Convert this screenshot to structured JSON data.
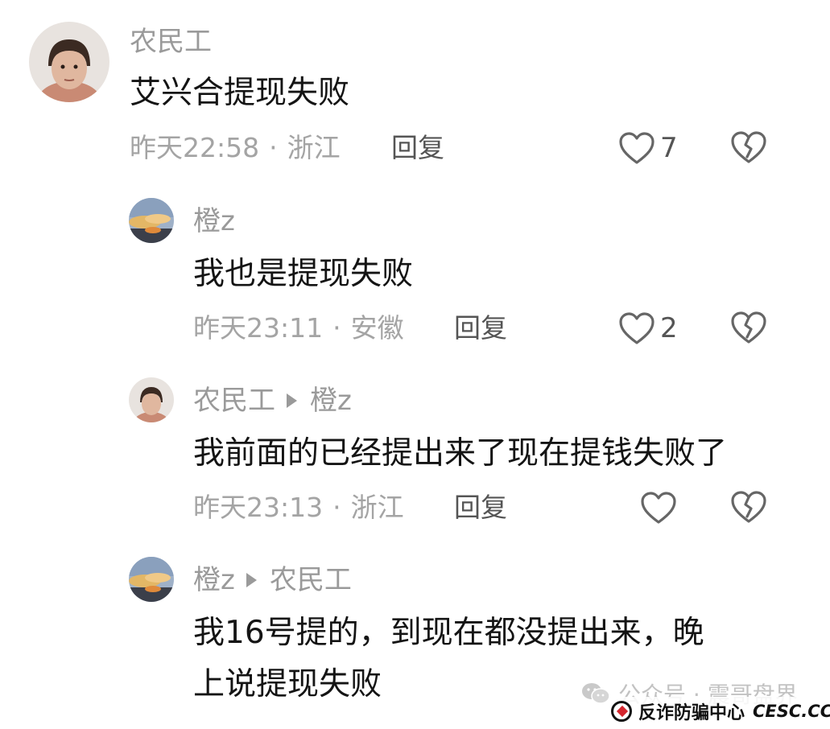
{
  "comments": [
    {
      "user": "农民工",
      "reply_to": "",
      "text_lines": [
        "艾兴合提现失败"
      ],
      "time": "昨天22:58",
      "location": "浙江",
      "reply_label": "回复",
      "likes": "7"
    },
    {
      "user": "橙z",
      "reply_to": "",
      "text_lines": [
        "我也是提现失败"
      ],
      "time": "昨天23:11",
      "location": "安徽",
      "reply_label": "回复",
      "likes": "2"
    },
    {
      "user": "农民工",
      "reply_to": "橙z",
      "text_lines": [
        "我前面的已经提出来了现在提钱失败了"
      ],
      "time": "昨天23:13",
      "location": "浙江",
      "reply_label": "回复",
      "likes": ""
    },
    {
      "user": "橙z",
      "reply_to": "农民工",
      "text_lines": [
        "我16号提的，到现在都没提出来，晚",
        "上说提现失败"
      ],
      "time": "",
      "location": "",
      "reply_label": "",
      "likes": ""
    }
  ],
  "separator": "·",
  "watermark": {
    "account": "公众号 · 震哥盘界",
    "org": "反诈防骗中心",
    "site": "CESC.CC"
  },
  "icons": {
    "like": "heart-outline-icon",
    "dislike": "broken-heart-icon",
    "reply_arrow": "triangle-right-icon",
    "wechat": "wechat-icon"
  },
  "colors": {
    "username": "#9a9a9a",
    "text": "#141414",
    "meta": "#a4a4a4",
    "reply": "#555555"
  }
}
